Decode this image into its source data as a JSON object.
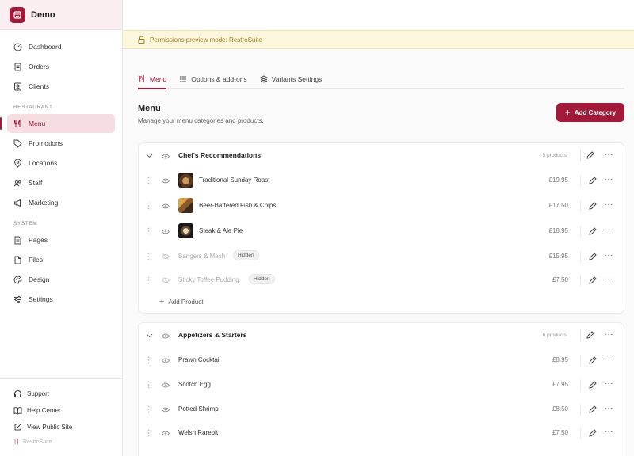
{
  "brand": {
    "name": "Demo"
  },
  "sidebar": {
    "items": [
      {
        "label": "Dashboard",
        "icon": "dashboard-icon"
      },
      {
        "label": "Orders",
        "icon": "receipt-icon"
      },
      {
        "label": "Clients",
        "icon": "contact-icon"
      }
    ],
    "restaurant_section": "RESTAURANT",
    "restaurant_items": [
      {
        "label": "Menu",
        "icon": "utensils-icon",
        "active": true
      },
      {
        "label": "Promotions",
        "icon": "tag-icon"
      },
      {
        "label": "Locations",
        "icon": "map-pin-icon"
      },
      {
        "label": "Staff",
        "icon": "users-icon"
      },
      {
        "label": "Marketing",
        "icon": "megaphone-icon"
      }
    ],
    "system_section": "SYSTEM",
    "system_items": [
      {
        "label": "Pages",
        "icon": "page-icon"
      },
      {
        "label": "Files",
        "icon": "file-icon"
      },
      {
        "label": "Design",
        "icon": "palette-icon"
      },
      {
        "label": "Settings",
        "icon": "sliders-icon"
      }
    ],
    "bottom": {
      "support": "Support",
      "help_center": "Help Center",
      "view_public_site": "View Public Site",
      "powered_by": "RestroSuite"
    }
  },
  "banner": {
    "text": "Permissions preview mode: RestroSuite"
  },
  "tabs": [
    {
      "label": "Menu",
      "active": true
    },
    {
      "label": "Options & add-ons"
    },
    {
      "label": "Variants Settings"
    }
  ],
  "page": {
    "title": "Menu",
    "subtitle": "Manage your menu categories and products.",
    "add_category_label": "Add Category"
  },
  "categories": [
    {
      "name": "Chef's Recommendations",
      "count": "5 products",
      "products": [
        {
          "name": "Traditional Sunday Roast",
          "price": "£19.95",
          "thumb": true,
          "hidden": false
        },
        {
          "name": "Beer-Battered Fish & Chips",
          "price": "£17.50",
          "thumb": true,
          "hidden": false
        },
        {
          "name": "Steak & Ale Pie",
          "price": "£18.95",
          "thumb": true,
          "hidden": false
        },
        {
          "name": "Bangers & Mash",
          "price": "£15.95",
          "thumb": false,
          "hidden": true
        },
        {
          "name": "Sticky Toffee Pudding",
          "price": "£7.50",
          "thumb": false,
          "hidden": true
        }
      ],
      "add_product_label": "Add Product",
      "hidden_badge": "Hidden"
    },
    {
      "name": "Appetizers & Starters",
      "count": "6 products",
      "products": [
        {
          "name": "Prawn Cocktail",
          "price": "£8.95"
        },
        {
          "name": "Scotch Egg",
          "price": "£7.95"
        },
        {
          "name": "Potted Shrimp",
          "price": "£8.50"
        },
        {
          "name": "Welsh Rarebit",
          "price": "£7.50"
        }
      ]
    }
  ],
  "colors": {
    "accent": "#a3193a",
    "banner_bg": "#fcf6dc",
    "banner_text": "#a17c24"
  }
}
